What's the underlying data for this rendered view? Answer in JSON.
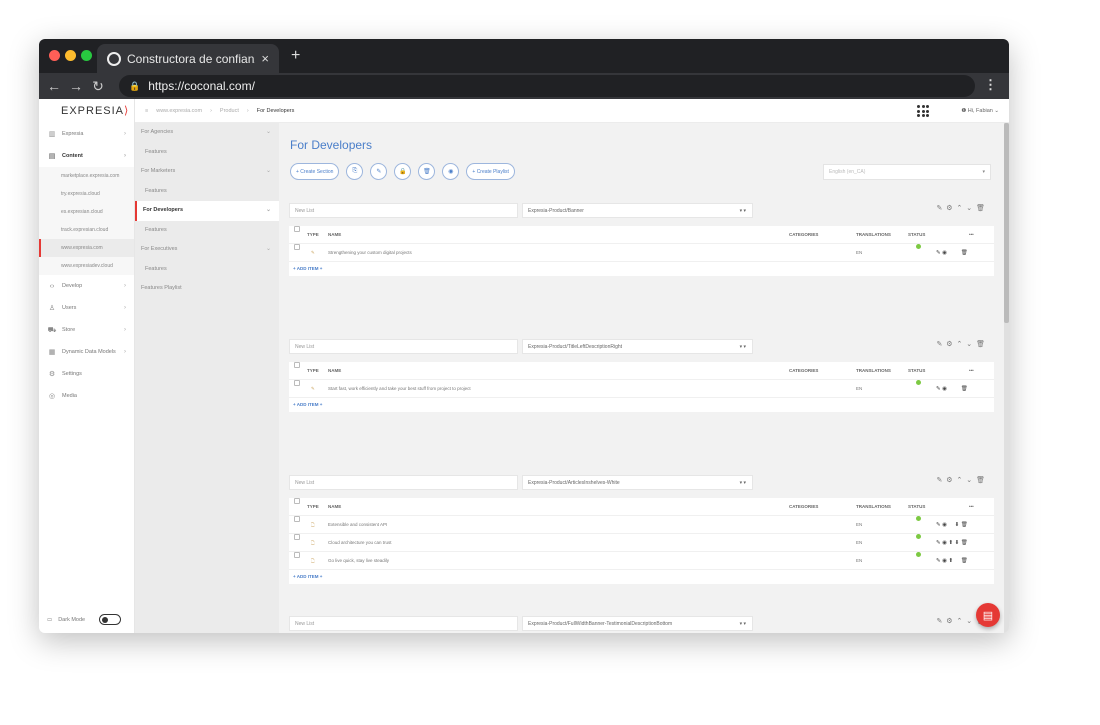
{
  "browser": {
    "tab_title": "Constructora de confianza...",
    "tab_close": "×",
    "new_tab": "+",
    "url": "https://coconal.com/",
    "traffic_colors": [
      "#ff5f57",
      "#febc2e",
      "#28c840"
    ]
  },
  "logo": {
    "text": "EXPRESIA",
    "mark": "⟩"
  },
  "sidebar": {
    "items": [
      {
        "label": "Expresia",
        "icon": "chart-icon",
        "glyph": "▥"
      },
      {
        "label": "Content",
        "icon": "document-icon",
        "glyph": "▤"
      }
    ],
    "sites": [
      "marketplace.expresia.com",
      "try.expresia.cloud",
      "es.expresian.cloud",
      "track.expresian.cloud",
      "www.expresia.com",
      "www.expresiadev.cloud"
    ],
    "selected_site_index": 4,
    "items2": [
      {
        "label": "Develop",
        "icon": "code-icon",
        "glyph": "‹›"
      },
      {
        "label": "Users",
        "icon": "users-icon",
        "glyph": "♙"
      },
      {
        "label": "Store",
        "icon": "cart-icon",
        "glyph": "⛟"
      },
      {
        "label": "Dynamic Data Models",
        "icon": "table-icon",
        "glyph": "▦"
      },
      {
        "label": "Settings",
        "icon": "gear-icon",
        "glyph": "⚙"
      },
      {
        "label": "Media",
        "icon": "camera-icon",
        "glyph": "◎"
      }
    ],
    "dark_mode": "Dark Mode"
  },
  "pages": [
    {
      "label": "For Agencies",
      "sub": false,
      "active": false
    },
    {
      "label": "Features",
      "sub": true,
      "active": false
    },
    {
      "label": "For Marketers",
      "sub": false,
      "active": false
    },
    {
      "label": "Features",
      "sub": true,
      "active": false
    },
    {
      "label": "For Developers",
      "sub": false,
      "active": true
    },
    {
      "label": "Features",
      "sub": true,
      "active": false
    },
    {
      "label": "For Executives",
      "sub": false,
      "active": false
    },
    {
      "label": "Features",
      "sub": true,
      "active": false
    },
    {
      "label": "Features Playlist",
      "sub": false,
      "active": false
    }
  ],
  "breadcrumb": {
    "home": "≡",
    "site": "www.expresia.com",
    "product": "Product",
    "current": "For Developers",
    "sep": "›"
  },
  "user": {
    "info": "❶ Hi, Fabian ⌄"
  },
  "main": {
    "title": "For Developers",
    "create_section": "+ Create Section",
    "create_playlist": "+ Create Playlist",
    "tool_icons": [
      {
        "name": "copy-icon",
        "glyph": "⎘"
      },
      {
        "name": "edit-icon",
        "glyph": "✎"
      },
      {
        "name": "lock-icon",
        "glyph": "🔒"
      },
      {
        "name": "trash-icon",
        "glyph": "🗑"
      },
      {
        "name": "eye-icon",
        "glyph": "◉"
      }
    ],
    "language": "English (en_CA)"
  },
  "table_header": {
    "type": "TYPE",
    "name": "NAME",
    "categories": "CATEGORIES",
    "translations": "TRANSLATIONS",
    "status": "STATUS",
    "more": "•••"
  },
  "section_actions": "✎ ⚙ ⌃ ⌄ 🗑",
  "sections": [
    {
      "list": "New List",
      "template": "Expresia-Product/Banner",
      "rows": [
        {
          "type": "✎",
          "name": "Strengthening your custom digital projects",
          "lang": "EN",
          "actions": "✎ ◉         🗑"
        }
      ]
    },
    {
      "list": "New List",
      "template": "Expresia-Product/TitleLeftDescriptionRight",
      "rows": [
        {
          "type": "✎",
          "name": "Start fast, work efficiently and take your best stuff from project to project",
          "lang": "EN",
          "actions": "✎ ◉         🗑"
        }
      ]
    },
    {
      "list": "New List",
      "template": "Expresia-Product/ArticlesInshelves-White",
      "rows": [
        {
          "type": "🗋",
          "name": "Extensible and consistent API",
          "lang": "EN",
          "actions": "✎ ◉     ⬇ 🗑"
        },
        {
          "type": "🗋",
          "name": "Cloud architecture you can trust",
          "lang": "EN",
          "actions": "✎ ◉ ⬆ ⬇ 🗑"
        },
        {
          "type": "🗋",
          "name": "Go live quick, stay live steadily",
          "lang": "EN",
          "actions": "✎ ◉ ⬆     🗑"
        }
      ]
    },
    {
      "list": "New List",
      "template": "Expresia-Product/FullWidthBanner-TestimonialDescriptionBottom",
      "rows": []
    }
  ],
  "add_item": "+ ADD ITEM +",
  "select_caret": "▾ ▾",
  "fab": "▤"
}
